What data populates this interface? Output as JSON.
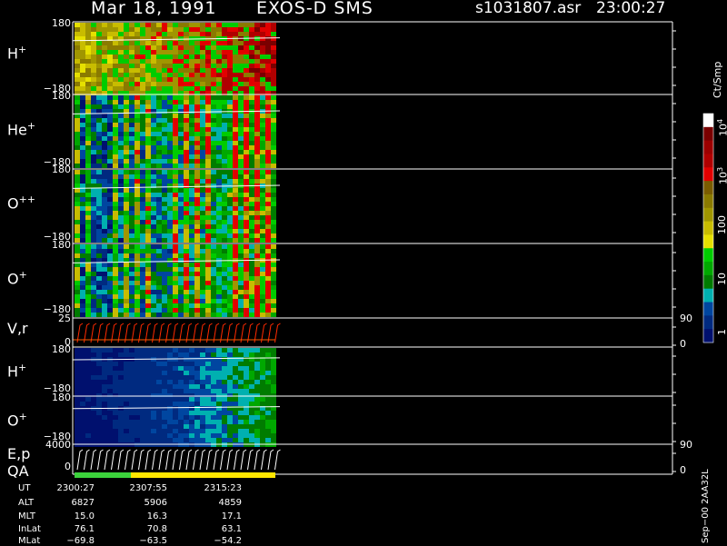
{
  "header": {
    "date": "Mar 18, 1991",
    "mission": "EXOS-D SMS",
    "file": "s1031807.asr",
    "time": "23:00:27"
  },
  "panels": [
    {
      "id": "h_plus_pa",
      "label": "H",
      "sup": "+",
      "ytop": "180",
      "ybot": "−180",
      "scheme": "warm"
    },
    {
      "id": "he_plus_pa",
      "label": "He",
      "sup": "+",
      "ytop": "180",
      "ybot": "−180",
      "scheme": "mid"
    },
    {
      "id": "o_pp_pa",
      "label": "O",
      "sup": "++",
      "ytop": "180",
      "ybot": "−180",
      "scheme": "mid"
    },
    {
      "id": "o_plus_pa",
      "label": "O",
      "sup": "+",
      "ytop": "180",
      "ybot": "−180",
      "scheme": "mid"
    },
    {
      "id": "vr",
      "label": "V,r",
      "sup": "",
      "ytop": "25",
      "ybot": "0",
      "rtop": "90",
      "rbot": "0",
      "scheme": "line-red"
    },
    {
      "id": "h_plus_2",
      "label": "H",
      "sup": "+",
      "ytop": "180",
      "ybot": "−180",
      "scheme": "cool"
    },
    {
      "id": "o_plus_2",
      "label": "O",
      "sup": "+",
      "ytop": "180",
      "ybot": "−180",
      "scheme": "cool"
    },
    {
      "id": "ep",
      "label": "E,p",
      "sup": "",
      "label2": "QA",
      "ytop": "4000",
      "ybot": "0",
      "rtop": "90",
      "rbot": "0",
      "scheme": "line-white"
    }
  ],
  "colorbar": {
    "unit": "Ct/Smp",
    "ticks": [
      {
        "base": "10",
        "exp": "4"
      },
      {
        "base": "10",
        "exp": "3"
      },
      {
        "base": "100",
        "exp": ""
      },
      {
        "base": "10",
        "exp": ""
      },
      {
        "base": "1",
        "exp": ""
      }
    ],
    "colors": [
      "#ffffff",
      "#7a0000",
      "#9c0000",
      "#b00000",
      "#e20000",
      "#7a5c00",
      "#8a7a00",
      "#a09600",
      "#c8bc00",
      "#e6e000",
      "#00cc00",
      "#00a800",
      "#007c00",
      "#00b0b0",
      "#0046a0",
      "#002a80",
      "#00106e"
    ]
  },
  "ephemeris": {
    "rows": [
      {
        "label": "UT",
        "values": [
          "2300:27",
          "2307:55",
          "2315:23"
        ]
      },
      {
        "label": "ALT",
        "values": [
          "6827",
          "5906",
          "4859"
        ]
      },
      {
        "label": "MLT",
        "values": [
          "15.0",
          "16.3",
          "17.1"
        ]
      },
      {
        "label": "InLat",
        "values": [
          "76.1",
          "70.8",
          "63.1"
        ]
      },
      {
        "label": "MLat",
        "values": [
          "−69.8",
          "−63.5",
          "−54.2"
        ]
      }
    ]
  },
  "footer_note": "Sep−00 2AA32L",
  "colors": {
    "background": "#000000",
    "axes": "#ffffff",
    "qa_green": "#3cd23c",
    "qa_yellow": "#ffe600"
  }
}
